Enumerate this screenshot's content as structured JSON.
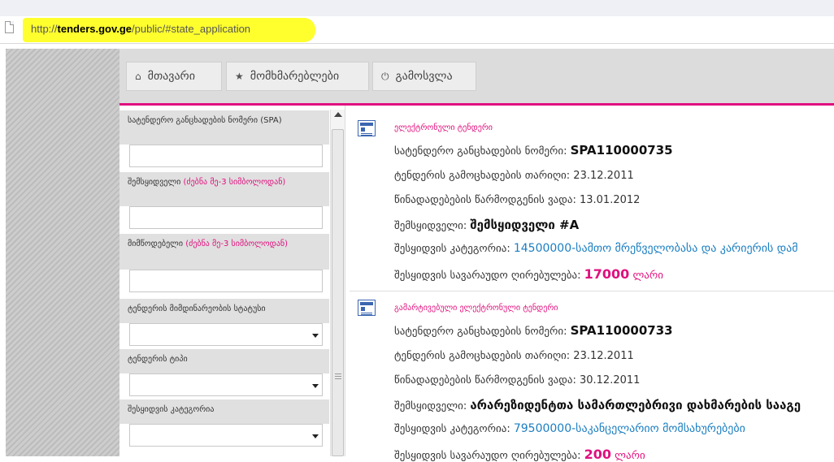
{
  "browser": {
    "url_protocol": "http://",
    "url_domain": "tenders.gov.ge",
    "url_path": "/public/#state_application"
  },
  "nav": {
    "items": [
      {
        "icon": "home-icon",
        "glyph": "⌂",
        "label": "მთავარი"
      },
      {
        "icon": "star-icon",
        "glyph": "★",
        "label": "მომხმარებლები"
      },
      {
        "icon": "power-icon",
        "glyph": "⏻",
        "label": "გამოსვლა"
      }
    ]
  },
  "sidebar": {
    "fields": [
      {
        "label": "სატენდერო განცხადების ნომერი (SPA)",
        "note": "",
        "type": "input"
      },
      {
        "label": "შემსყიდველი",
        "note": "(ძებნა მე-3 სიმბოლოდან)",
        "type": "input"
      },
      {
        "label": "მიმწოდებელი",
        "note": "(ძებნა მე-3 სიმბოლოდან)",
        "type": "input"
      },
      {
        "label": "ტენდერის მიმდინარეობის სტატუსი",
        "note": "",
        "type": "select"
      },
      {
        "label": "ტენდერის ტიპი",
        "note": "",
        "type": "select"
      },
      {
        "label": "შესყიდვის კატეგორია",
        "note": "",
        "type": "select"
      }
    ]
  },
  "tenders": [
    {
      "type": "ელექტრონული ტენდერი",
      "number_label": "სატენდერო განცხადების ნომერი:",
      "number": "SPA110000735",
      "announce_label": "ტენდერის გამოცხადების თარიღი:",
      "announce_date": "23.12.2011",
      "deadline_label": "წინადადებების წარმოდგენის ვადა:",
      "deadline": "13.01.2012",
      "buyer_label": "შემსყიდველი:",
      "buyer": "შემსყიდველი #A",
      "category_label": "შესყიდვის კატეგორია:",
      "category": "14500000-სამთო მრეწველობასა და კარიერის დამ",
      "value_label": "შესყიდვის სავარაუდო ღირებულება:",
      "value": "17000",
      "currency": "ლარი"
    },
    {
      "type": "გამარტივებული ელექტრონული ტენდერი",
      "number_label": "სატენდერო განცხადების ნომერი:",
      "number": "SPA110000733",
      "announce_label": "ტენდერის გამოცხადების თარიღი:",
      "announce_date": "23.12.2011",
      "deadline_label": "წინადადებების წარმოდგენის ვადა:",
      "deadline": "30.12.2011",
      "buyer_label": "შემსყიდველი:",
      "buyer": "არარეზიდენტთა სამართლებრივი დახმარების სააგე",
      "category_label": "შესყიდვის კატეგორია:",
      "category": "79500000-საკანცელარიო მომსახურებები",
      "value_label": "შესყიდვის სავარაუდო ღირებულება:",
      "value": "200",
      "currency": "ლარი"
    }
  ]
}
